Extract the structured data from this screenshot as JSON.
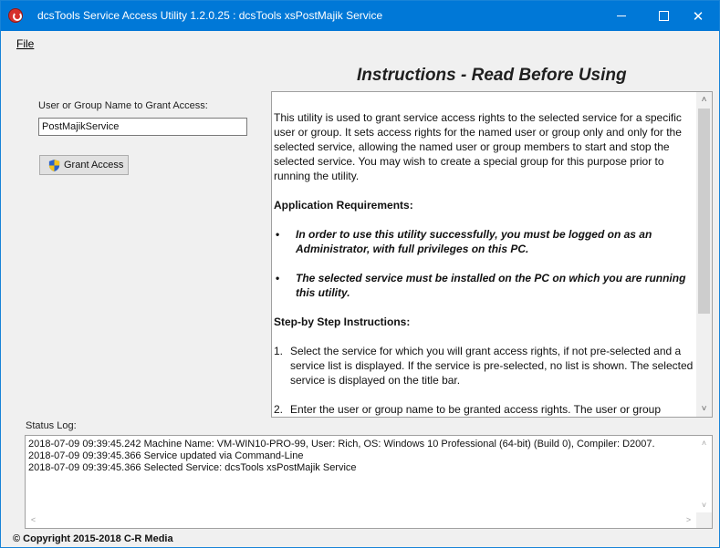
{
  "window": {
    "title": "dcsTools Service Access Utility 1.2.0.25 : dcsTools xsPostMajik Service",
    "minimize_glyph": "—",
    "maximize_glyph": "□",
    "close_glyph": "✕"
  },
  "menu": {
    "file": "File"
  },
  "left": {
    "user_label": "User or Group Name to Grant Access:",
    "user_value": "PostMajikService",
    "grant_button": "Grant Access"
  },
  "instructions": {
    "title": "Instructions - Read Before Using",
    "intro": "This utility is used to grant service access rights to the selected service for a specific user or group. It sets access rights for the named user or group only and only for the selected service, allowing the named user or group members to start and stop the selected service. You may wish to create a special group for this purpose prior to running the utility.",
    "requirements_heading": "Application Requirements:",
    "requirements": [
      "In order to use this utility successfully, you must be logged on as an Administrator, with full privileges on this PC.",
      "The selected service must be installed on the PC on which you are running this utility."
    ],
    "steps_heading": "Step-by Step Instructions:",
    "steps": [
      {
        "num": "1.",
        "text": "Select the service for which you will grant access rights, if not pre-selected and a service list is displayed. If the service is pre-selected, no list is shown. The selected service is displayed on the title bar."
      },
      {
        "num": "2.",
        "text": "Enter the user or group name to be granted access rights. The user or group"
      }
    ],
    "scroll_up": "˄",
    "scroll_down": "˅"
  },
  "status": {
    "label": "Status Log:",
    "lines": [
      "2018-07-09 09:39:45.242 Machine Name: VM-WIN10-PRO-99, User: Rich, OS: Windows 10 Professional (64-bit) (Build 0), Compiler: D2007.",
      "2018-07-09 09:39:45.366 Service updated via Command-Line",
      "2018-07-09 09:39:45.366 Selected Service: dcsTools xsPostMajik Service"
    ],
    "scroll_up": "˄",
    "scroll_down": "˅",
    "scroll_left": "<",
    "scroll_right": ">"
  },
  "footer": {
    "copyright": "© Copyright 2015-2018 C-R Media"
  },
  "colors": {
    "titlebar": "#0078d7",
    "accent": "#0078d7"
  },
  "icons": {
    "app": "dcstools-app-icon",
    "shield": "uac-shield-icon"
  }
}
